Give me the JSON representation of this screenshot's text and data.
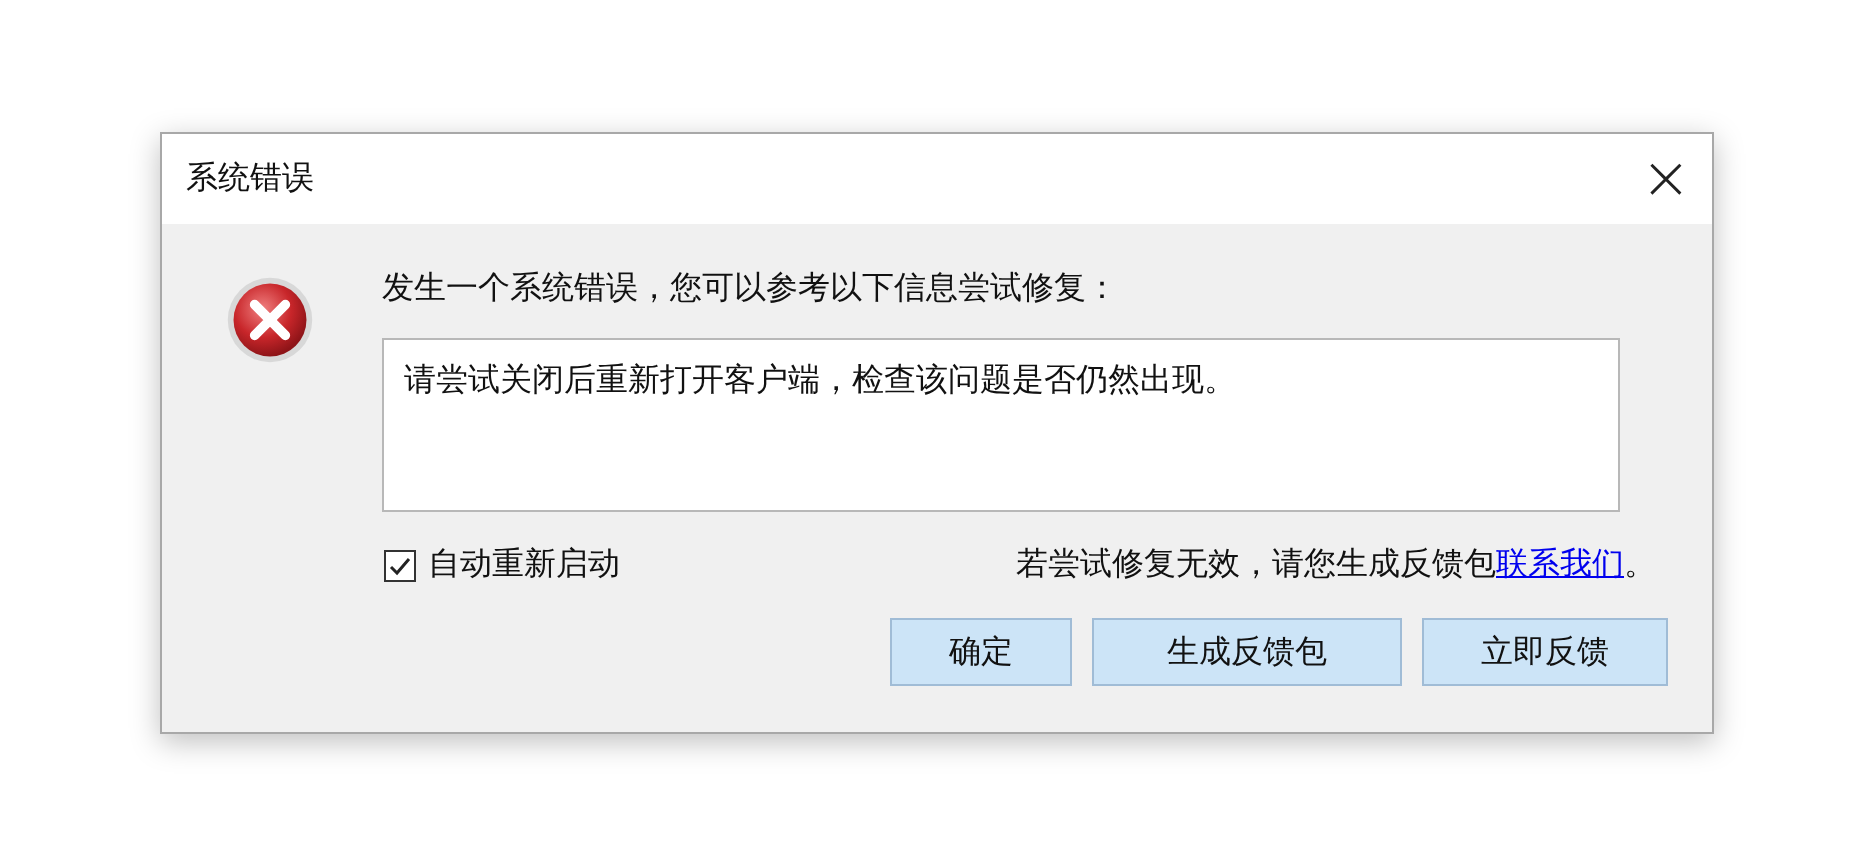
{
  "window": {
    "title": "系统错误",
    "close": "×"
  },
  "message": "发生一个系统错误，您可以参考以下信息尝试修复：",
  "details": {
    "value": "请尝试关闭后重新打开客户端，检查该问题是否仍然出现。"
  },
  "auto_restart": {
    "label": "自动重新启动",
    "checked": true
  },
  "hint": {
    "text": "若尝试修复无效，请您生成反馈包",
    "link": "联系我们",
    "suffix": "。"
  },
  "buttons": [
    "确定",
    "生成反馈包",
    "立即反馈"
  ]
}
